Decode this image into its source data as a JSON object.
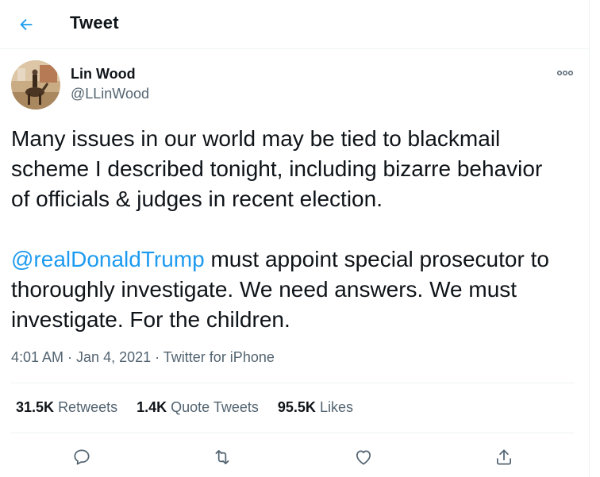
{
  "header": {
    "back_icon": "arrow-left-icon",
    "title": "Tweet"
  },
  "author": {
    "name": "Lin Wood",
    "handle": "@LLinWood",
    "avatar": "avatar-photo"
  },
  "tweet": {
    "paragraph1_lines": [
      "Many issues in our world may be tied to blackmail",
      "scheme I described tonight, including bizarre behavior",
      "of officials & judges in recent election."
    ],
    "mention": "@realDonaldTrump",
    "paragraph2_line1_rest": " must appoint special prosecutor to",
    "paragraph2_lines": [
      "thoroughly investigate. We need answers. We must",
      "investigate. For the children."
    ]
  },
  "meta": {
    "time": "4:01 AM",
    "separator": " · ",
    "date": "Jan 4, 2021",
    "source": "Twitter for iPhone"
  },
  "stats": {
    "retweets_count": "31.5K",
    "retweets_label": "Retweets",
    "quotes_count": "1.4K",
    "quotes_label": "Quote Tweets",
    "likes_count": "95.5K",
    "likes_label": "Likes"
  },
  "actions": {
    "reply_icon": "reply-icon",
    "retweet_icon": "retweet-icon",
    "like_icon": "heart-icon",
    "share_icon": "share-icon"
  },
  "colors": {
    "accent": "#1d9bf0",
    "text": "#0f1419",
    "secondary": "#536471",
    "border": "#eff3f4"
  }
}
